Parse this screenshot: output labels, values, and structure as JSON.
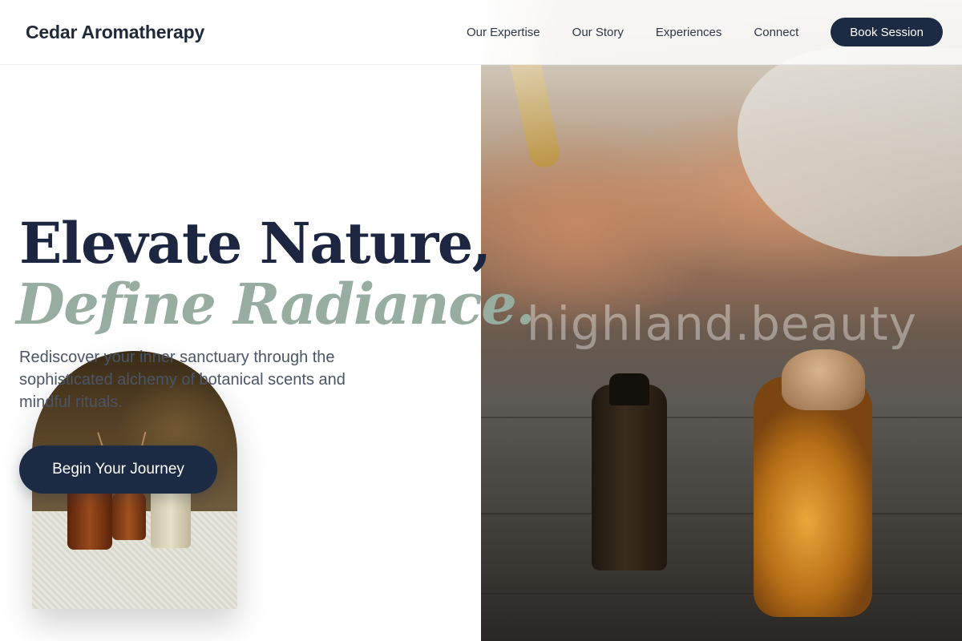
{
  "header": {
    "brand": "Cedar Aromatherapy",
    "nav": [
      "Our Expertise",
      "Our Story",
      "Experiences",
      "Connect"
    ],
    "cta_label": "Book Session"
  },
  "hero": {
    "title_line1": "Elevate Nature,",
    "title_line2": "Define Radiance.",
    "subtitle": "Rediscover your inner sanctuary through the sophisticated alchemy of botanical scents and mindful rituals.",
    "cta_label": "Begin Your Journey"
  },
  "photo": {
    "watermark": "highland.beauty"
  },
  "colors": {
    "navy": "#1c2a44",
    "sage": "#97ada0",
    "text_muted": "#4a5567"
  }
}
